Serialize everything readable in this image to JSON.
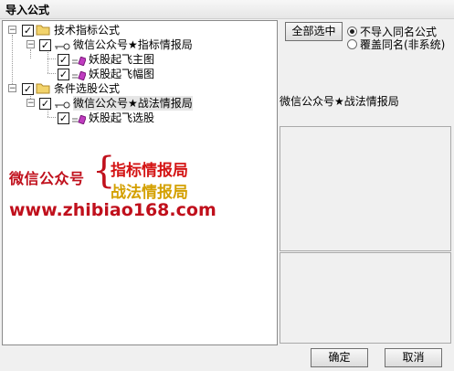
{
  "window": {
    "title": "导入公式"
  },
  "tree": {
    "groups": [
      {
        "label": "技术指标公式",
        "sub": [
          {
            "label": "微信公众号★指标情报局",
            "items": [
              "妖股起飞主图",
              "妖股起飞幅图"
            ]
          }
        ]
      },
      {
        "label": "条件选股公式",
        "sub": [
          {
            "label": "微信公众号★战法情报局",
            "items": [
              "妖股起飞选股"
            ]
          }
        ]
      }
    ],
    "expand_symbol": "−",
    "check_symbol": "✓"
  },
  "promo": {
    "left": "微信公众号",
    "brace": "{",
    "line1": "指标情报局",
    "line2": "战法情报局",
    "url": "www.zhibiao168.com"
  },
  "options": {
    "select_all_label": "全部选中",
    "radio_skip_label": "不导入同名公式",
    "radio_overwrite_label": "覆盖同名(非系统)",
    "selected": "skip"
  },
  "info": {
    "text": "微信公众号★战法情报局"
  },
  "footer": {
    "ok_label": "确定",
    "cancel_label": "取消"
  },
  "colors": {
    "promo_red": "#c0101c",
    "promo_gold": "#d4a000"
  }
}
